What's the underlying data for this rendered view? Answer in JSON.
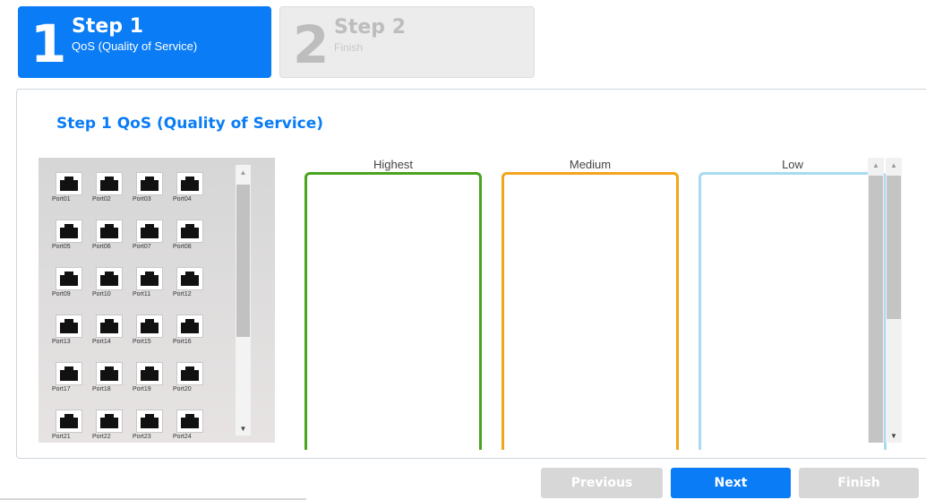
{
  "wizard": {
    "steps": [
      {
        "number": "1",
        "title": "Step 1",
        "subtitle": "QoS (Quality of Service)"
      },
      {
        "number": "2",
        "title": "Step 2",
        "subtitle": "Finish"
      }
    ]
  },
  "panel": {
    "title": "Step 1 QoS (Quality of Service)"
  },
  "ports": [
    "Port01",
    "Port02",
    "Port03",
    "Port04",
    "Port05",
    "Port06",
    "Port07",
    "Port08",
    "Port09",
    "Port10",
    "Port11",
    "Port12",
    "Port13",
    "Port14",
    "Port15",
    "Port16",
    "Port17",
    "Port18",
    "Port19",
    "Port20",
    "Port21",
    "Port22",
    "Port23",
    "Port24"
  ],
  "queues": [
    {
      "label": "Highest",
      "color": "#4aa320"
    },
    {
      "label": "Medium",
      "color": "#f2a51a"
    },
    {
      "label": "Low",
      "color": "#a8daf0"
    }
  ],
  "buttons": {
    "previous": "Previous",
    "next": "Next",
    "finish": "Finish"
  },
  "colors": {
    "accent": "#0a7cf5",
    "disabled": "#d7d7d7"
  }
}
